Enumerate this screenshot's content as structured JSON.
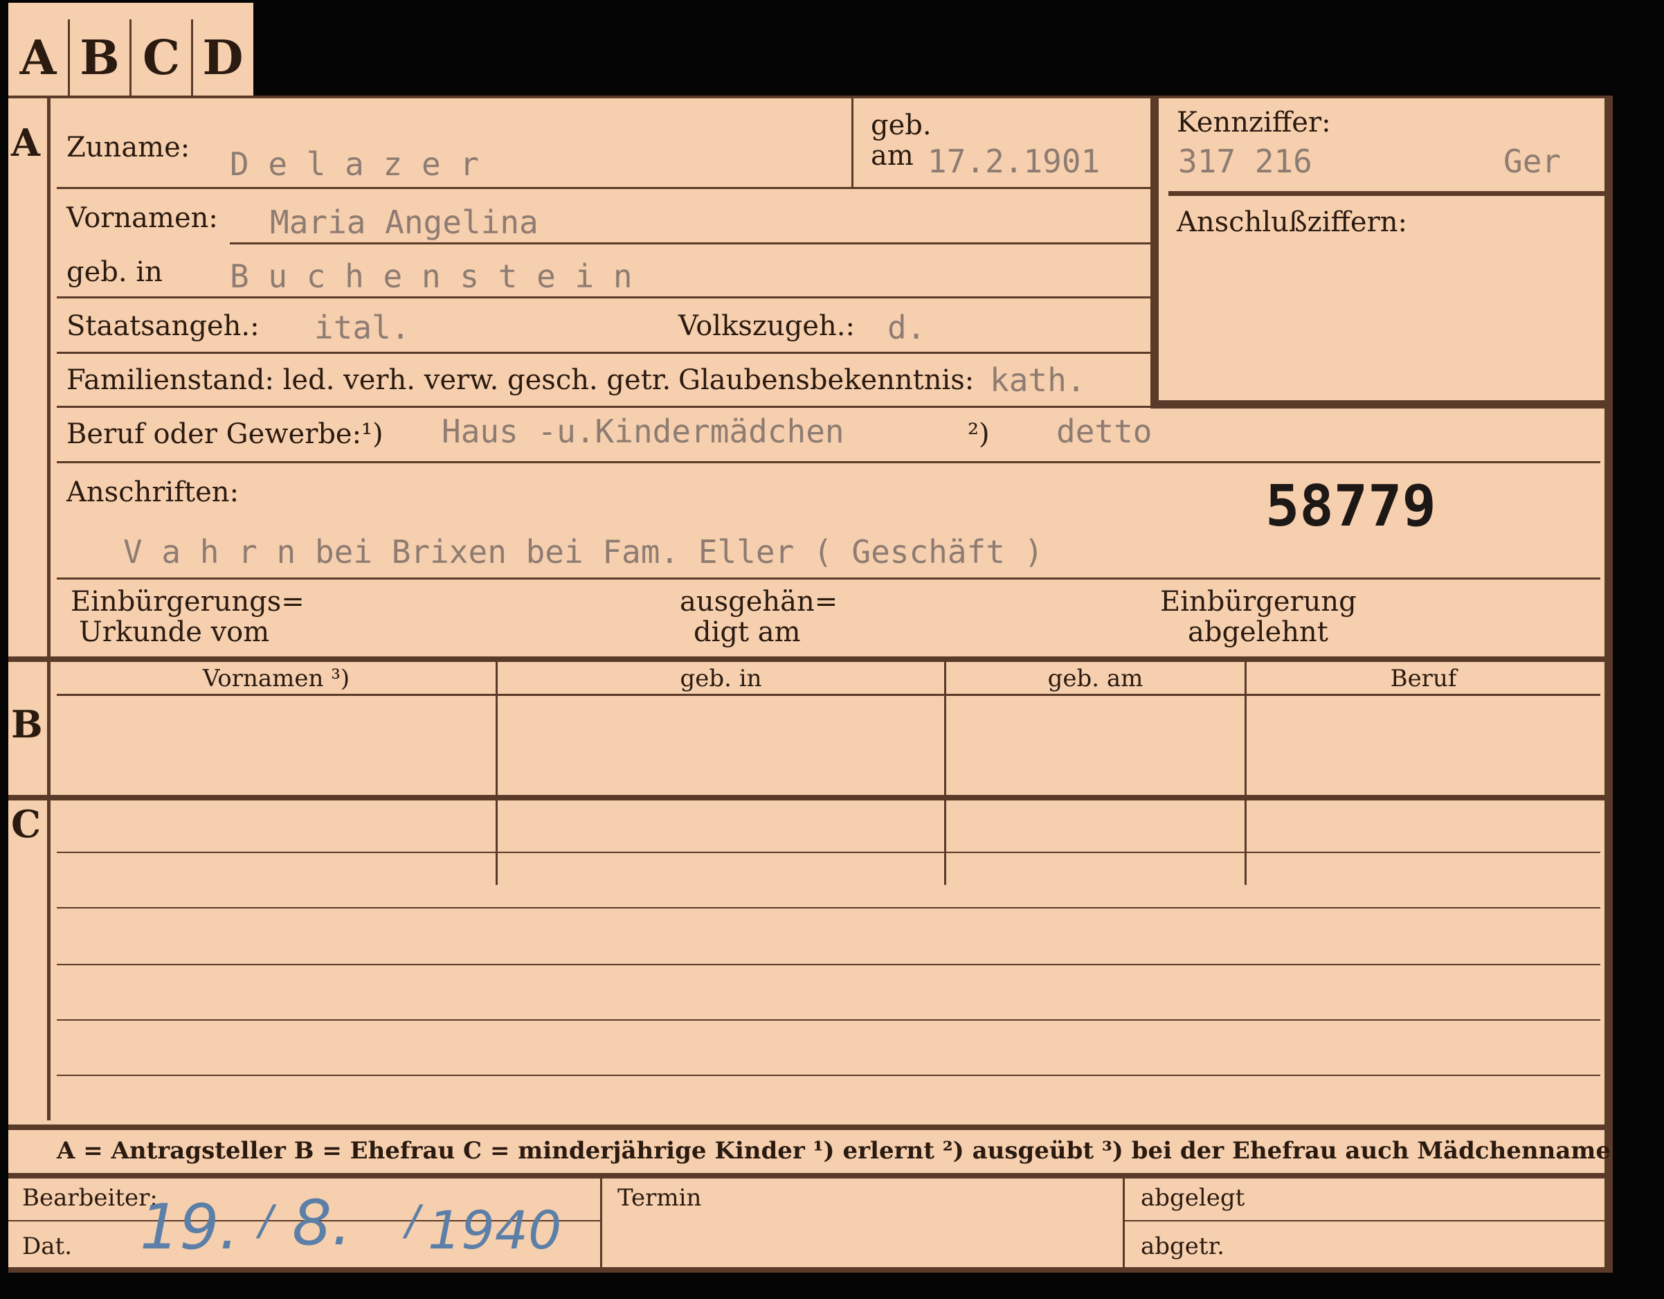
{
  "tabs": [
    "A",
    "B",
    "C",
    "D"
  ],
  "section_a": {
    "marker": "A",
    "zuname_label": "Zuname:",
    "zuname_value": "D e l a z e r",
    "geb_label": "geb.",
    "am_label": "am",
    "geb_am_value": "17.2.1901",
    "kennziffer_label": "Kennziffer:",
    "kennziffer_value": "317 216",
    "kennziffer_suffix": "Ger",
    "anschluss_label": "Anschlußziffern:",
    "vornamen_label": "Vornamen:",
    "vornamen_value": "Maria Angelina",
    "geb_in_label": "geb. in",
    "geb_in_value": "B u c h e n s t e i n",
    "staatsangeh_label": "Staatsangeh.:",
    "staatsangeh_value": "ital.",
    "volkszugeh_label": "Volkszugeh.:",
    "volkszugeh_value": "d.",
    "familienstand_label": "Familienstand: led. verh. verw. gesch. getr.",
    "glauben_label": "Glaubensbekenntnis:",
    "glauben_value": "kath.",
    "beruf_label": "Beruf oder Gewerbe:",
    "beruf_mark1": "¹)",
    "beruf_value1": "Haus -u.Kindermädchen",
    "beruf_mark2": "²)",
    "beruf_value2": "detto",
    "anschriften_label": "Anschriften:",
    "anschriften_value": "V a h r n bei Brixen bei Fam. Eller ( Geschäft )",
    "card_number": "58779",
    "einb_urkunde_line1": "Einbürgerungs=",
    "einb_urkunde_line2": "Urkunde vom",
    "ausgehaen_line1": "ausgehän=",
    "ausgehaen_line2": "digt am",
    "einb_abgelehnt_line1": "Einbürgerung",
    "einb_abgelehnt_line2": "abgelehnt"
  },
  "section_b": {
    "marker": "B",
    "columns": [
      "Vornamen ³)",
      "geb. in",
      "geb. am",
      "Beruf"
    ]
  },
  "section_c": {
    "marker": "C"
  },
  "legend": "A = Antragsteller   B = Ehefrau   C = minderjährige Kinder   ¹) erlernt   ²) ausgeübt   ³) bei der Ehefrau auch Mädchenname",
  "footer": {
    "bearbeiter_label": "Bearbeiter:",
    "dat_label": "Dat.",
    "date_day": "19.",
    "date_sep1": "/",
    "date_month": "8.",
    "date_sep2": "/",
    "date_year": "1940",
    "termin_label": "Termin",
    "abgelegt_label": "abgelegt",
    "abgetr_label": "abgetr."
  },
  "colors": {
    "card": "#f6cfae",
    "ink": "#2a1a10",
    "typewriter": "#8e7c72",
    "handwriting": "#5c7fa8",
    "background": "#050505"
  }
}
